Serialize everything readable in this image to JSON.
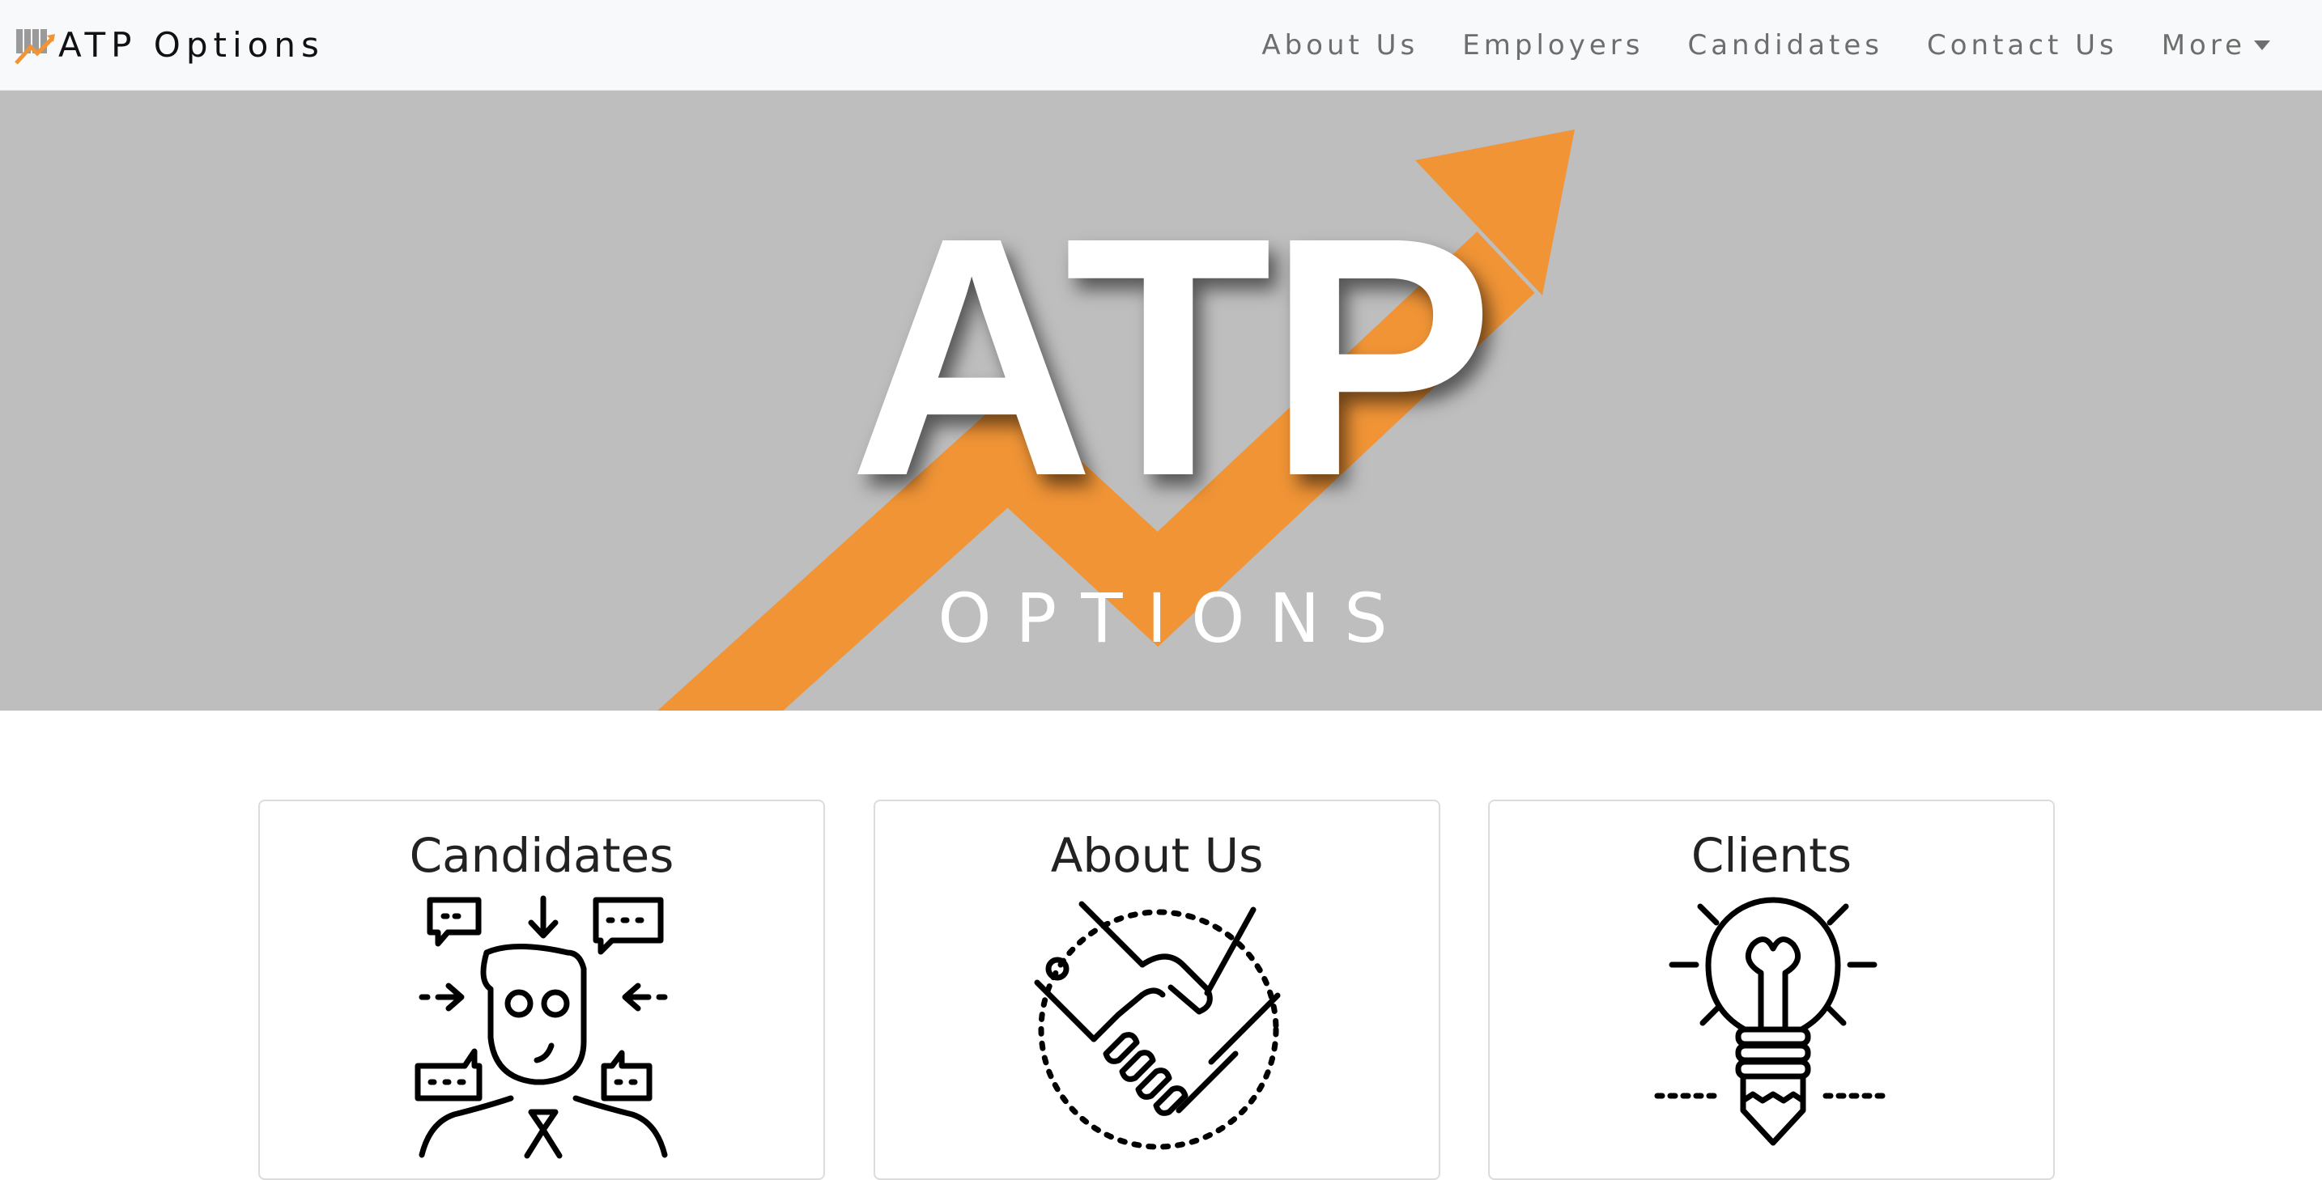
{
  "navbar": {
    "brand": "ATP Options",
    "links": [
      {
        "label": "About Us"
      },
      {
        "label": "Employers"
      },
      {
        "label": "Candidates"
      },
      {
        "label": "Contact Us"
      },
      {
        "label": "More"
      }
    ]
  },
  "hero": {
    "title": "ATP",
    "subtitle": "OPTIONS",
    "colors": {
      "background": "#bebebe",
      "arrow": "#f09436",
      "text": "#ffffff"
    }
  },
  "cards": [
    {
      "title": "Candidates",
      "icon": "person-ideas-icon"
    },
    {
      "title": "About Us",
      "icon": "handshake-icon"
    },
    {
      "title": "Clients",
      "icon": "lightbulb-icon"
    }
  ]
}
